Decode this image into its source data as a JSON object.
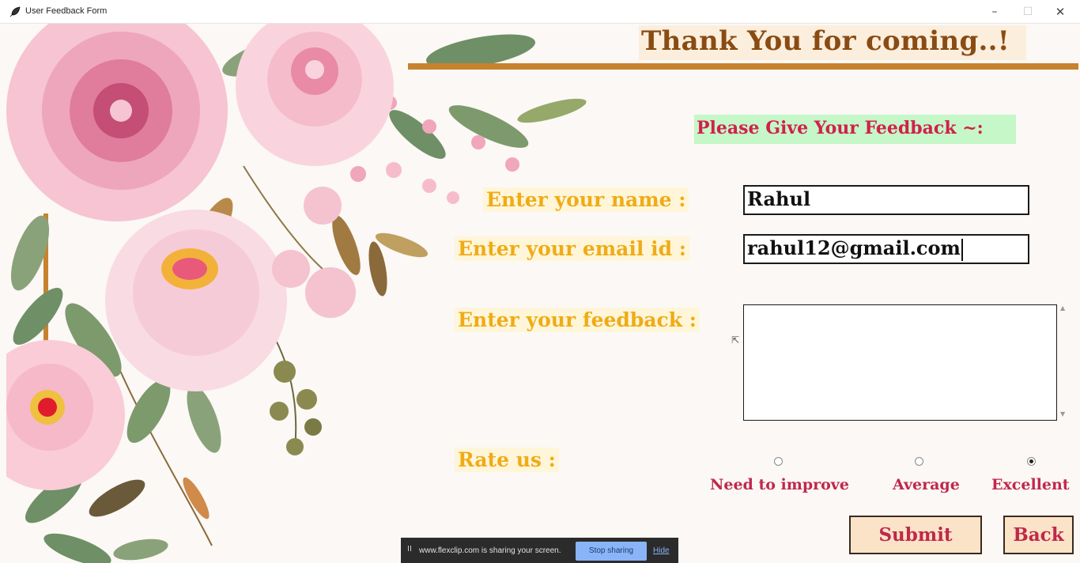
{
  "window": {
    "title": "User Feedback Form",
    "app_icon": "feather-app-icon",
    "minimize_icon": "–",
    "maximize_icon": "☐",
    "close_icon": "✕"
  },
  "header": {
    "title": "Thank You for coming..!",
    "subtitle": "Please Give Your Feedback ~:"
  },
  "form": {
    "name": {
      "label": "Enter your name :",
      "value": "Rahul"
    },
    "email": {
      "label": "Enter your email id :",
      "value": "rahul12@gmail.com"
    },
    "feedback": {
      "label": "Enter your feedback :",
      "value": ""
    },
    "rating": {
      "label": "Rate us :",
      "options": [
        {
          "label": "Need to improve",
          "selected": false
        },
        {
          "label": "Average",
          "selected": false
        },
        {
          "label": "Excellent",
          "selected": true
        }
      ]
    }
  },
  "buttons": {
    "submit": "Submit",
    "back": "Back"
  },
  "share_banner": {
    "pause_icon": "II",
    "message": "www.flexclip.com is sharing your screen.",
    "stop": "Stop sharing",
    "hide": "Hide"
  },
  "colors": {
    "title": "#8a4b12",
    "label": "#f0ab16",
    "accent": "#c0284a",
    "rule": "#c8822e",
    "subtitle_bg": "#c5f7c8"
  }
}
